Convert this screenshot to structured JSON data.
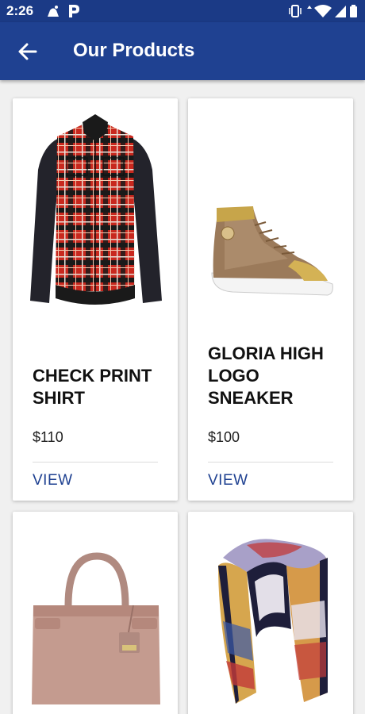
{
  "status_bar": {
    "time": "2:26"
  },
  "app_bar": {
    "title": "Our Products",
    "back_icon": "arrow-left-icon"
  },
  "products": [
    {
      "name": "CHECK PRINT SHIRT",
      "price": "$110",
      "action": "VIEW",
      "image": "plaid-shirt-image"
    },
    {
      "name": "GLORIA HIGH LOGO SNEAKER",
      "price": "$100",
      "action": "VIEW",
      "image": "high-top-sneaker-image"
    },
    {
      "name": "",
      "price": "",
      "action": "",
      "image": "handbag-image"
    },
    {
      "name": "",
      "price": "",
      "action": "",
      "image": "scarf-image"
    }
  ],
  "colors": {
    "status_bar": "#1b3a86",
    "app_bar": "#1f4191",
    "accent": "#1f4191",
    "background": "#f0f0f0"
  }
}
